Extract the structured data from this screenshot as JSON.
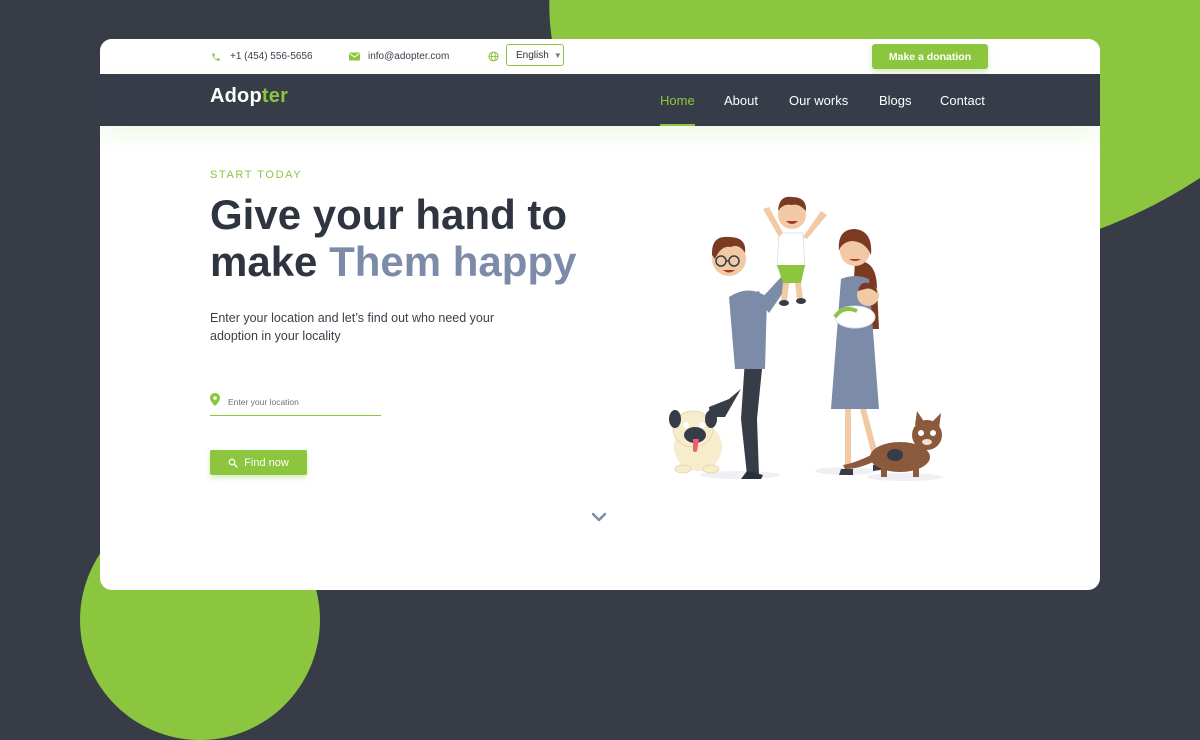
{
  "topbar": {
    "phone": "+1 (454) 556-5656",
    "email": "info@adopter.com",
    "language": "English",
    "donate_label": "Make a donation"
  },
  "nav": {
    "logo_main": "Adop",
    "logo_accent": "ter",
    "items": [
      {
        "label": "Home",
        "active": true
      },
      {
        "label": "About",
        "active": false
      },
      {
        "label": "Our works",
        "active": false
      },
      {
        "label": "Blogs",
        "active": false
      },
      {
        "label": "Contact",
        "active": false
      }
    ]
  },
  "hero": {
    "eyebrow": "START TODAY",
    "title_line1": "Give your hand to",
    "title_line2_plain": "make ",
    "title_line2_highlight": "Them happy",
    "subtitle": "Enter your location and let’s find out who need your adoption in your locality",
    "location_placeholder": "Enter your location",
    "location_value": "",
    "find_label": "Find now"
  },
  "icons": {
    "phone": "phone-icon",
    "email": "mail-icon",
    "globe": "globe-icon",
    "location": "location-pin-icon",
    "search": "search-icon",
    "scroll": "chevron-down-icon"
  },
  "colors": {
    "accent": "#8cc63f",
    "dark": "#363c48",
    "background": "#373c47",
    "highlight_text": "#7b8ba8"
  }
}
